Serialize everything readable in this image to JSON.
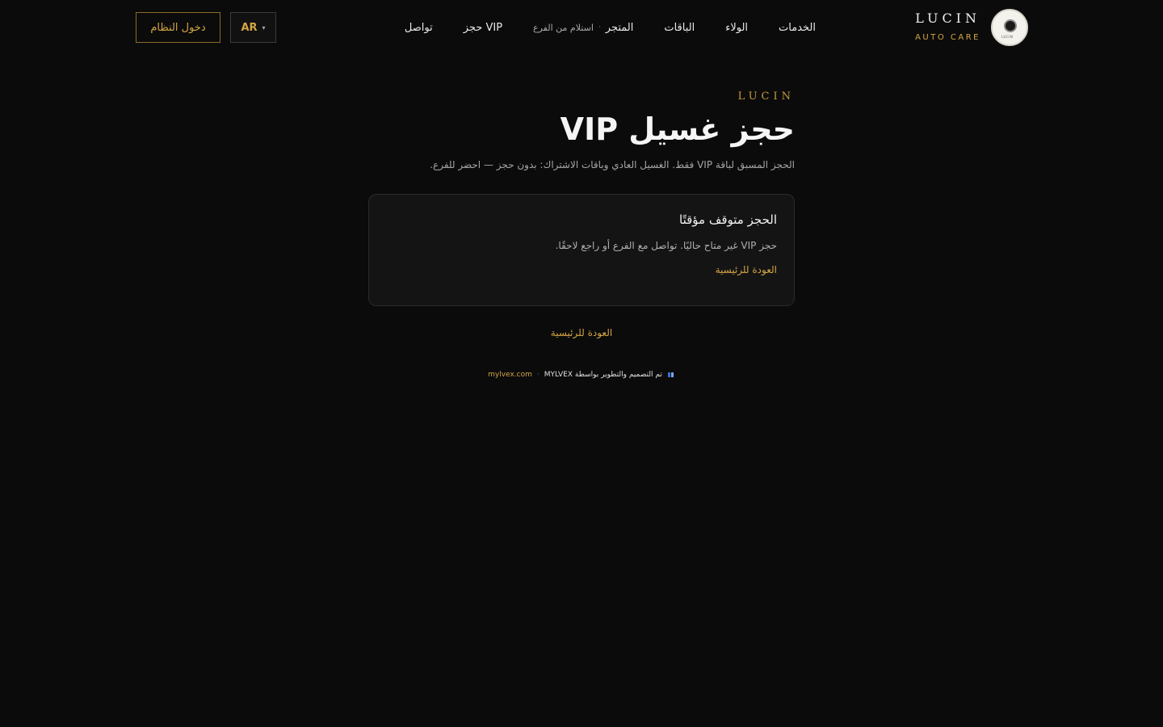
{
  "brand": {
    "name": "LUCIN",
    "tagline": "AUTO CARE",
    "logo_text": "LUCIN"
  },
  "nav": {
    "items": [
      {
        "label": "الخدمات"
      },
      {
        "label": "الولاء"
      },
      {
        "label": "الباقات"
      },
      {
        "label": "المتجر",
        "sub": "استلام من الفرع"
      },
      {
        "label": "حجز VIP"
      },
      {
        "label": "تواصل"
      }
    ]
  },
  "header": {
    "lang_label": "AR",
    "lang_arrow": "▾",
    "login_label": "دخول النظام"
  },
  "page": {
    "eyebrow": "LUCIN",
    "title": "حجز غسيل VIP",
    "subtitle": "الحجز المسبق لباقة VIP فقط. الغسيل العادي وباقات الاشتراك: بدون حجز — احضر للفرع."
  },
  "notice": {
    "title": "الحجز متوقف مؤقتًا",
    "text": "حجز VIP غير متاح حاليًا. تواصل مع الفرع أو راجع لاحقًا.",
    "link": "العودة للرئيسية"
  },
  "home_link": "العودة للرئيسية",
  "footer": {
    "credit": "تم التصميم والتطوير بواسطة MYLVEX",
    "separator": "·",
    "link": "mylvex.com"
  },
  "colors": {
    "background": "#0b0b0b",
    "accent": "#d4a544",
    "card": "#141414"
  }
}
